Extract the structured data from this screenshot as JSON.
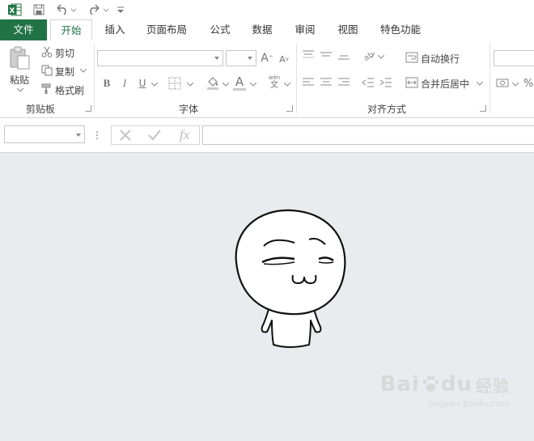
{
  "quick_access": {
    "icons": [
      "excel-logo-icon",
      "save-icon",
      "undo-icon",
      "redo-icon",
      "customize-qat-icon"
    ]
  },
  "tabs": {
    "file": "文件",
    "home": "开始",
    "insert": "插入",
    "page_layout": "页面布局",
    "formulas": "公式",
    "data": "数据",
    "review": "审阅",
    "view": "视图",
    "special": "特色功能"
  },
  "ribbon": {
    "clipboard": {
      "paste": "粘贴",
      "cut": "剪切",
      "copy": "复制",
      "format_painter": "格式刷",
      "label": "剪贴板"
    },
    "font": {
      "bold": "B",
      "italic": "I",
      "underline": "U",
      "font_color": "A",
      "phonetic_top": "wén",
      "phonetic_bottom": "文",
      "grow": "A",
      "shrink": "A",
      "label": "字体"
    },
    "alignment": {
      "wrap_text": "自动换行",
      "merge_center": "合并后居中",
      "label": "对齐方式"
    },
    "number": {
      "percent": "%"
    }
  },
  "formula_bar": {
    "fx": "fx",
    "name_box_value": "",
    "formula_value": ""
  },
  "watermark": {
    "brand": "Bai",
    "brand2": "du",
    "suffix": "经验",
    "url": "jingyan.baidu.com"
  },
  "colors": {
    "excel_green": "#217346",
    "canvas_bg": "#e9ebef"
  }
}
